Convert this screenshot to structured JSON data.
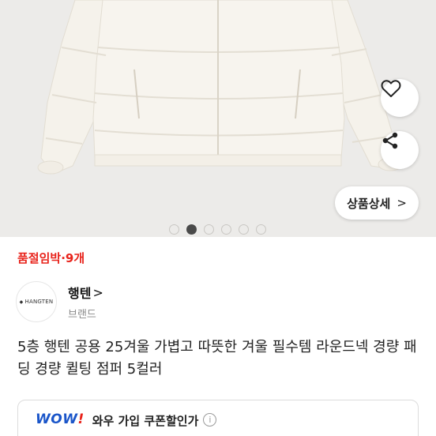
{
  "product": {
    "image_dots_count": 6,
    "active_dot_index": 1,
    "detail_button_label": "상품상세",
    "detail_button_chevron": ">",
    "stock_status": "품절임박·9개",
    "title": "5층 행텐 공용 25겨울 가볍고 따뜻한 겨울 필수템 라운드넥 경량 패딩 경량 퀼팅 점퍼 5컬러"
  },
  "brand": {
    "logo_text": "HANGTEN",
    "name": "행텐",
    "chevron": ">",
    "sub_label": "브랜드"
  },
  "coupon": {
    "wow_label": "WOW",
    "wow_bang": "!",
    "text": "와우 가입 쿠폰할인가",
    "info_icon": "i"
  },
  "colors": {
    "accent_red": "#e8221a",
    "wow_blue": "#1a55c9",
    "jacket": "#f6f3ec",
    "background": "#ecebe9"
  }
}
